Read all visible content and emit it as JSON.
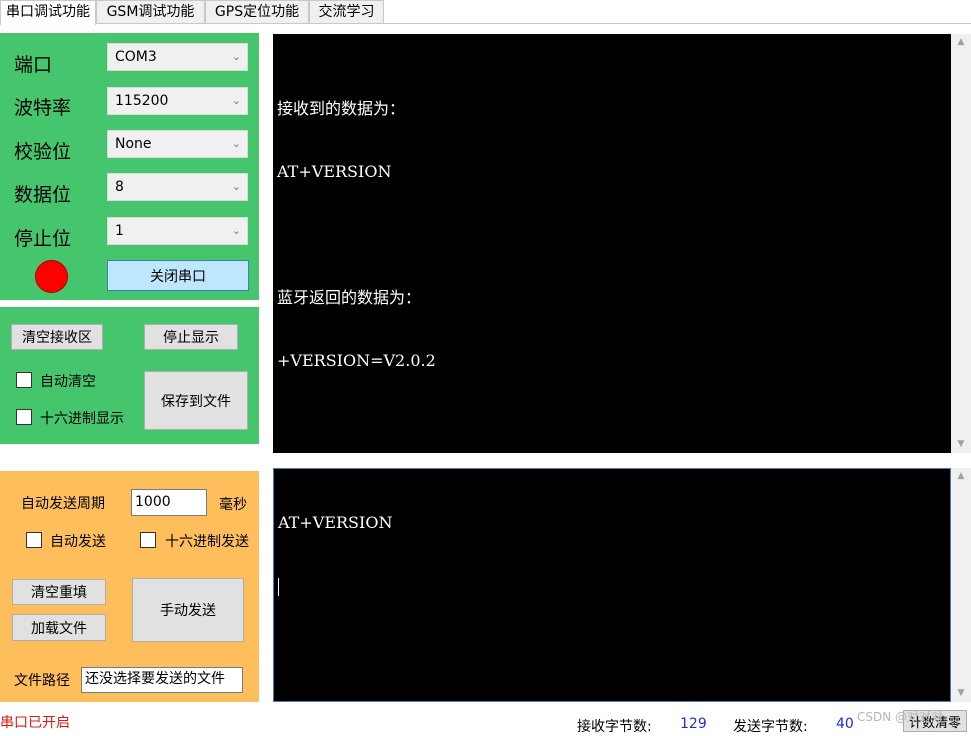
{
  "tabs": [
    {
      "label": "串口调试功能",
      "active": true
    },
    {
      "label": "GSM调试功能",
      "active": false
    },
    {
      "label": "GPS定位功能",
      "active": false
    },
    {
      "label": "交流学习",
      "active": false
    }
  ],
  "serial": {
    "port_label": "端口",
    "port_value": "COM3",
    "baud_label": "波特率",
    "baud_value": "115200",
    "parity_label": "校验位",
    "parity_value": "None",
    "databits_label": "数据位",
    "databits_value": "8",
    "stopbits_label": "停止位",
    "stopbits_value": "1",
    "close_port_button": "关闭串口",
    "indicator_color": "#ff0000"
  },
  "receive_controls": {
    "clear_receive_button": "清空接收区",
    "stop_display_button": "停止显示",
    "auto_clear_label": "自动清空",
    "hex_display_label": "十六进制显示",
    "save_to_file_button": "保存到文件"
  },
  "receive_console": {
    "lines": [
      "接收到的数据为：",
      "AT+VERSION",
      "",
      "蓝牙返回的数据为：",
      "+VERSION=V2.0.2"
    ]
  },
  "send_controls": {
    "auto_period_label": "自动发送周期",
    "auto_period_value": "1000",
    "ms_label": "毫秒",
    "auto_send_label": "自动发送",
    "hex_send_label": "十六进制发送",
    "clear_refill_button": "清空重填",
    "load_file_button": "加载文件",
    "manual_send_button": "手动发送",
    "file_path_label": "文件路径",
    "file_path_value": "还没选择要发送的文件"
  },
  "send_console": {
    "text": "AT+VERSION"
  },
  "status": {
    "port_status": "串口已开启",
    "rx_label": "接收字节数:",
    "rx_value": "129",
    "tx_label": "发送字节数:",
    "tx_value": "40",
    "count_clear_button": "计数清零",
    "watermark": "CSDN @对对对"
  },
  "colors": {
    "green_panel": "#45c66c",
    "orange_panel": "#ffbe5c",
    "console_bg": "#000000"
  }
}
